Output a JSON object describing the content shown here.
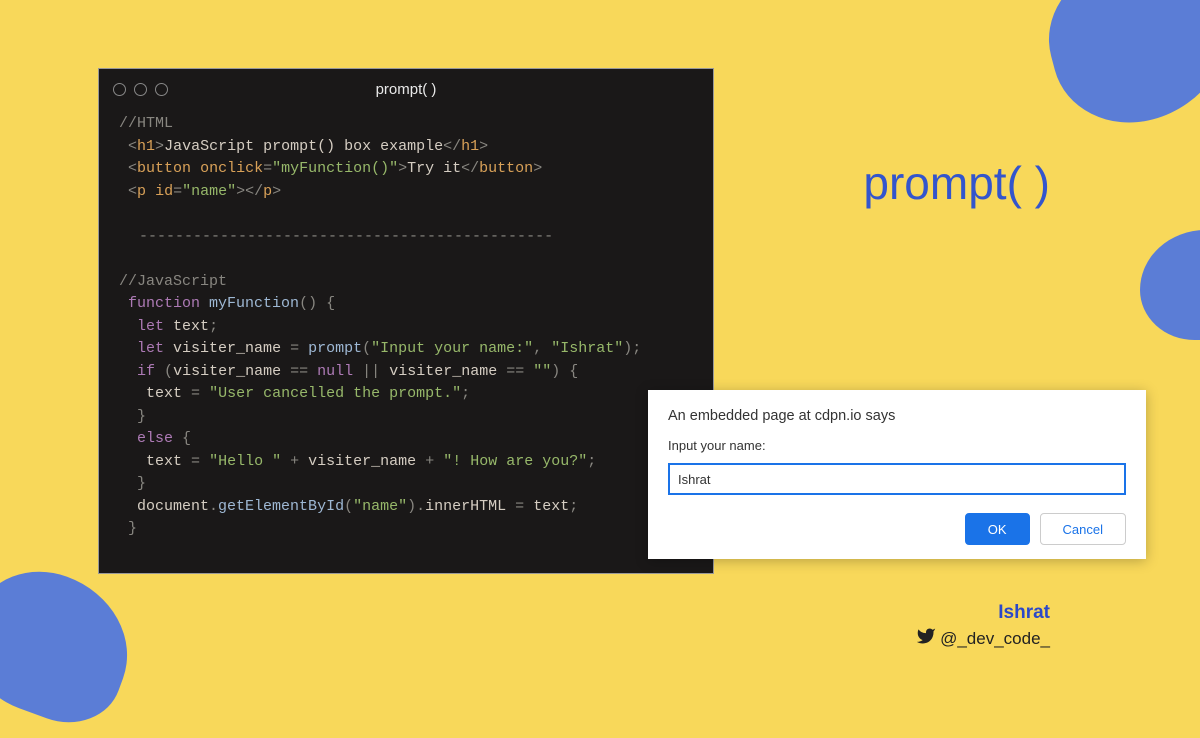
{
  "window": {
    "title": "prompt( )"
  },
  "code": {
    "comment_html": "//HTML",
    "h1_text": "JavaScript prompt() box example",
    "button_onclick": "\"myFunction()\"",
    "button_text": "Try it",
    "p_id": "\"name\"",
    "divider": "----------------------------------------------",
    "comment_js": "//JavaScript",
    "func_name": "myFunction",
    "let1": "let",
    "var_text": "text",
    "var_visiter": "visiter_name",
    "prompt_call": "prompt",
    "prompt_arg1": "\"Input your name:\"",
    "prompt_arg2": "\"Ishrat\"",
    "if_kw": "if",
    "null_kw": "null",
    "or": "||",
    "empty": "\"\"",
    "cancel_msg": "\"User cancelled the prompt.\"",
    "else_kw": "else",
    "hello": "\"Hello \"",
    "howru": "\"! How are you?\"",
    "doc": "document",
    "getby": "getElementById",
    "name_arg": "\"name\"",
    "inner": "innerHTML"
  },
  "heading": "prompt( )",
  "dialog": {
    "title": "An embedded page at cdpn.io says",
    "label": "Input your name:",
    "value": "Ishrat",
    "ok": "OK",
    "cancel": "Cancel"
  },
  "credit": {
    "name": "Ishrat",
    "handle": "@_dev_code_"
  }
}
